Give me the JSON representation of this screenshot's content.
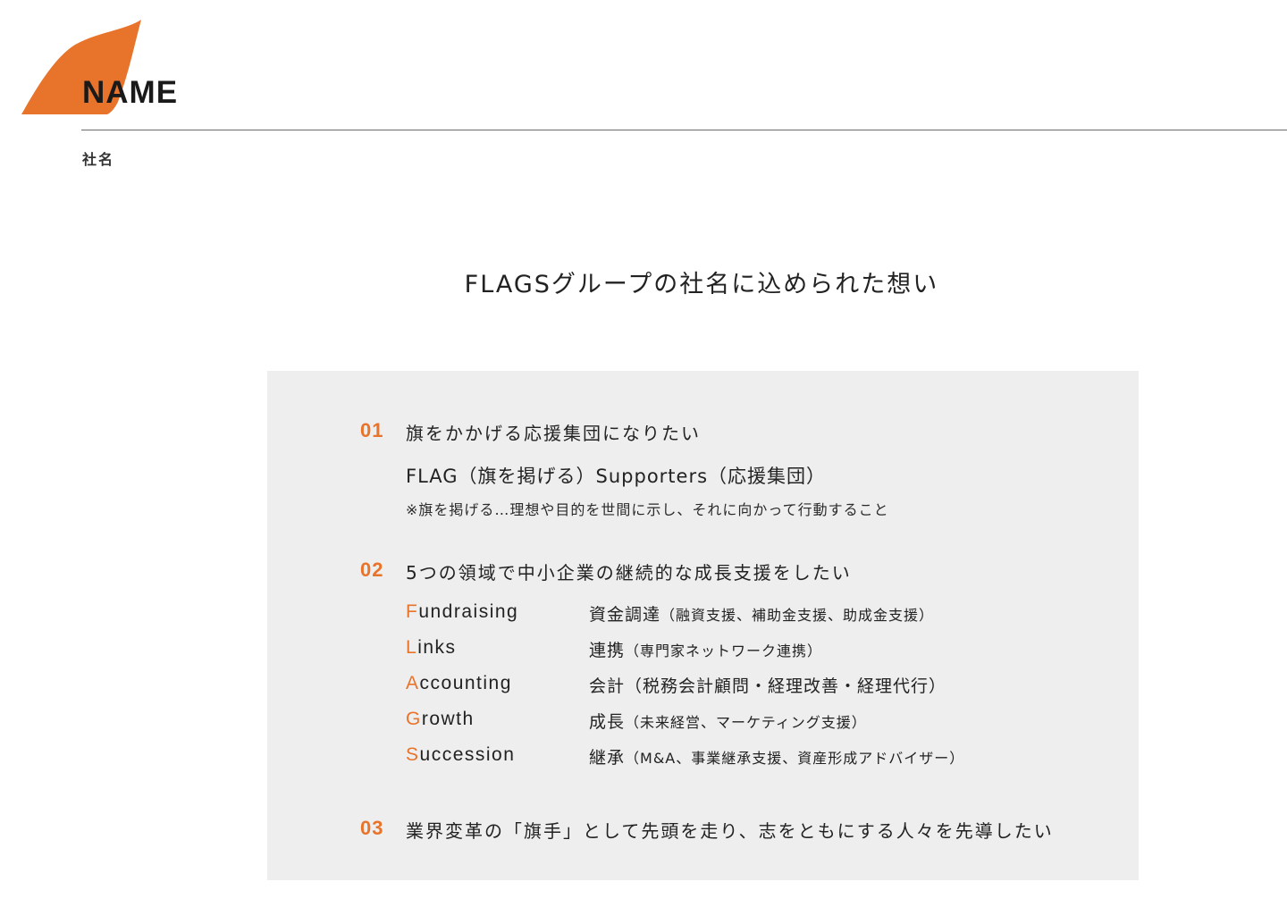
{
  "header": {
    "title": "NAME",
    "subtitle": "社名",
    "accent_color": "#e8732a"
  },
  "main": {
    "title": "FLAGSグループの社名に込められた想い",
    "points": [
      {
        "number": "01",
        "text": "旗をかかげる応援集団になりたい",
        "flag_line": "FLAG（旗を掲げる）Supporters（応援集団）",
        "note": "※旗を掲げる…理想や目的を世間に示し、それに向かって行動すること"
      },
      {
        "number": "02",
        "text": "5つの領域で中小企業の継続的な成長支援をしたい",
        "flags": [
          {
            "initial": "F",
            "rest": "undraising",
            "label": "資金調達",
            "detail": "（融資支援、補助金支援、助成金支援）"
          },
          {
            "initial": "L",
            "rest": "inks",
            "label": "連携",
            "detail": "（専門家ネットワーク連携）"
          },
          {
            "initial": "A",
            "rest": "ccounting",
            "label": "会計",
            "detail": "（税務会計顧問・経理改善・経理代行）"
          },
          {
            "initial": "G",
            "rest": "rowth",
            "label": "成長",
            "detail": "（未来経営、マーケティング支援）"
          },
          {
            "initial": "S",
            "rest": "uccession",
            "label": "継承",
            "detail": "（M&A、事業継承支援、資産形成アドバイザー）"
          }
        ]
      },
      {
        "number": "03",
        "text": "業界変革の「旗手」として先頭を走り、志をともにする人々を先導したい"
      }
    ]
  }
}
